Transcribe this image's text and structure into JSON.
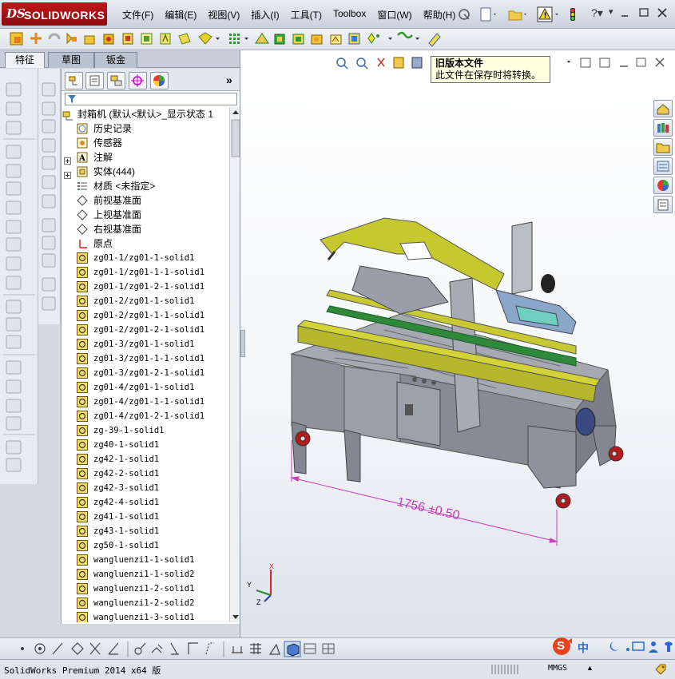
{
  "app": {
    "logo_ds": "DS",
    "logo_name": "SOLIDWORKS"
  },
  "menu": [
    "文件(F)",
    "编辑(E)",
    "视图(V)",
    "插入(I)",
    "工具(T)",
    "Toolbox",
    "窗口(W)",
    "帮助(H)"
  ],
  "window_controls": [
    "minimize-icon",
    "restore-icon",
    "close-icon"
  ],
  "tabs": [
    "特征",
    "草图",
    "钣金"
  ],
  "filter": {
    "icon": "filter-icon",
    "value": ""
  },
  "tree": {
    "root": "封箱机  (默认<默认>_显示状态 1",
    "items": [
      {
        "icon": "history-icon",
        "label": "历史记录"
      },
      {
        "icon": "sensor-icon",
        "label": "传感器"
      },
      {
        "icon": "annotation-icon",
        "label": "注解"
      },
      {
        "icon": "solid-bodies-icon",
        "label": "实体(444)"
      },
      {
        "icon": "material-icon",
        "label": "材质 <未指定>"
      },
      {
        "icon": "plane-icon",
        "label": "前视基准面"
      },
      {
        "icon": "plane-icon",
        "label": "上视基准面"
      },
      {
        "icon": "plane-icon",
        "label": "右视基准面"
      },
      {
        "icon": "origin-icon",
        "label": "原点"
      }
    ],
    "bodies": [
      "zg01-1/zg01-1-solid1",
      "zg01-1/zg01-1-1-solid1",
      "zg01-1/zg01-2-1-solid1",
      "zg01-2/zg01-1-solid1",
      "zg01-2/zg01-1-1-solid1",
      "zg01-2/zg01-2-1-solid1",
      "zg01-3/zg01-1-solid1",
      "zg01-3/zg01-1-1-solid1",
      "zg01-3/zg01-2-1-solid1",
      "zg01-4/zg01-1-solid1",
      "zg01-4/zg01-1-1-solid1",
      "zg01-4/zg01-2-1-solid1",
      "zg-39-1-solid1",
      "zg40-1-solid1",
      "zg42-1-solid1",
      "zg42-2-solid1",
      "zg42-3-solid1",
      "zg42-4-solid1",
      "zg41-1-solid1",
      "zg43-1-solid1",
      "zg50-1-solid1",
      "wangluenzi1-1-solid1",
      "wangluenzi1-1-solid2",
      "wangluenzi1-2-solid1",
      "wangluenzi1-2-solid2",
      "wangluenzi1-3-solid1"
    ]
  },
  "tooltip": {
    "title": "旧版本文件",
    "body": "此文件在保存时将转换。"
  },
  "model": {
    "dimension_label": "1756 ±0.50"
  },
  "triad": {
    "x": "X",
    "y": "Y",
    "z": "Z"
  },
  "ime": {
    "logo": "S",
    "lang": "中"
  },
  "status": {
    "left": "SolidWorks Premium 2014 x64 版",
    "units": "MMGS",
    "units_arrow": "▲"
  },
  "colors": {
    "brand_red": "#b3141a",
    "model_yellow": "#c8c832",
    "model_frame": "#8e929c",
    "dimension": "#d03dbc"
  }
}
